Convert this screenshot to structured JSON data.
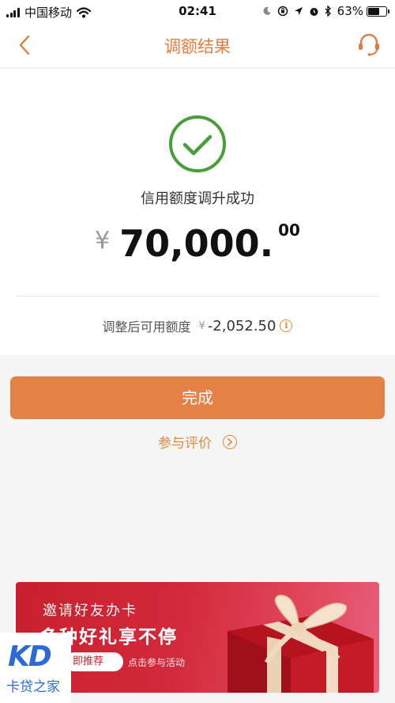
{
  "status_bar": {
    "carrier": "中国移动",
    "time": "02:41",
    "battery": "63%",
    "battery_level": 0.63
  },
  "nav": {
    "title": "调额结果"
  },
  "result": {
    "label": "信用额度调升成功",
    "currency": "¥",
    "amount_int": "70,000.",
    "amount_dec": "00",
    "available_label": "调整后可用额度",
    "available_currency": "¥",
    "available_value": "-2,052.50",
    "info_glyph": "i"
  },
  "actions": {
    "done_label": "完成",
    "feedback_label": "参与评价"
  },
  "banner": {
    "line1": "邀请好友办卡",
    "line2": "多种好礼享不停",
    "pill": "即推荐",
    "hint": "点击参与活动"
  },
  "watermark": {
    "logo": "KD",
    "text": "卡贷之家"
  },
  "colors": {
    "accent": "#e58146",
    "success": "#4a9e3a",
    "banner": "#c8202e",
    "watermark": "#2b6ad8"
  }
}
